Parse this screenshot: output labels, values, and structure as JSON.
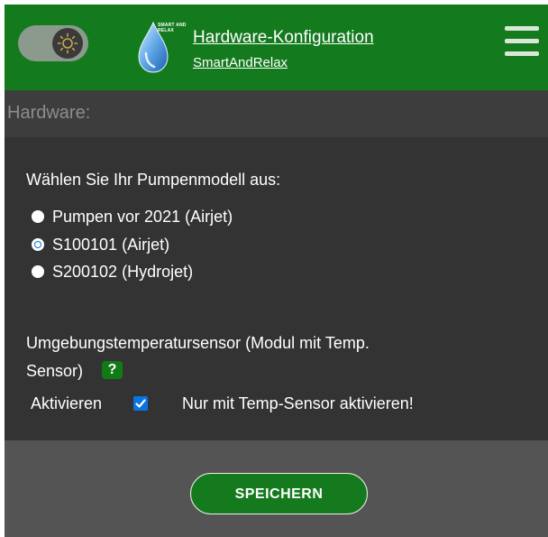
{
  "header": {
    "title": "Hardware-Konfiguration",
    "subtitle": "SmartAndRelax",
    "logo_text": "SMART AND RELAX",
    "toggle_icon": "sun-icon",
    "menu_icon": "hamburger-icon"
  },
  "section": {
    "label": "Hardware:"
  },
  "pump": {
    "prompt": "Wählen Sie Ihr Pumpenmodell aus:",
    "options": [
      {
        "label": "Pumpen vor 2021 (Airjet)",
        "selected": false
      },
      {
        "label": "S100101 (Airjet)",
        "selected": true
      },
      {
        "label": "S200102 (Hydrojet)",
        "selected": false
      }
    ]
  },
  "sensor": {
    "line1": "Umgebungstemperatursensor (Modul mit Temp.",
    "line2": "Sensor)",
    "help": "?",
    "activate_label": "Aktivieren",
    "activate_checked": true,
    "hint": "Nur mit Temp-Sensor aktivieren!"
  },
  "footer": {
    "save_label": "SPEICHERN"
  },
  "colors": {
    "header_bg": "#147a1e",
    "content_bg": "#333333",
    "section_bg": "#3d3d3d",
    "accent_blue": "#0a74e0",
    "button_bg": "#157a1d"
  }
}
